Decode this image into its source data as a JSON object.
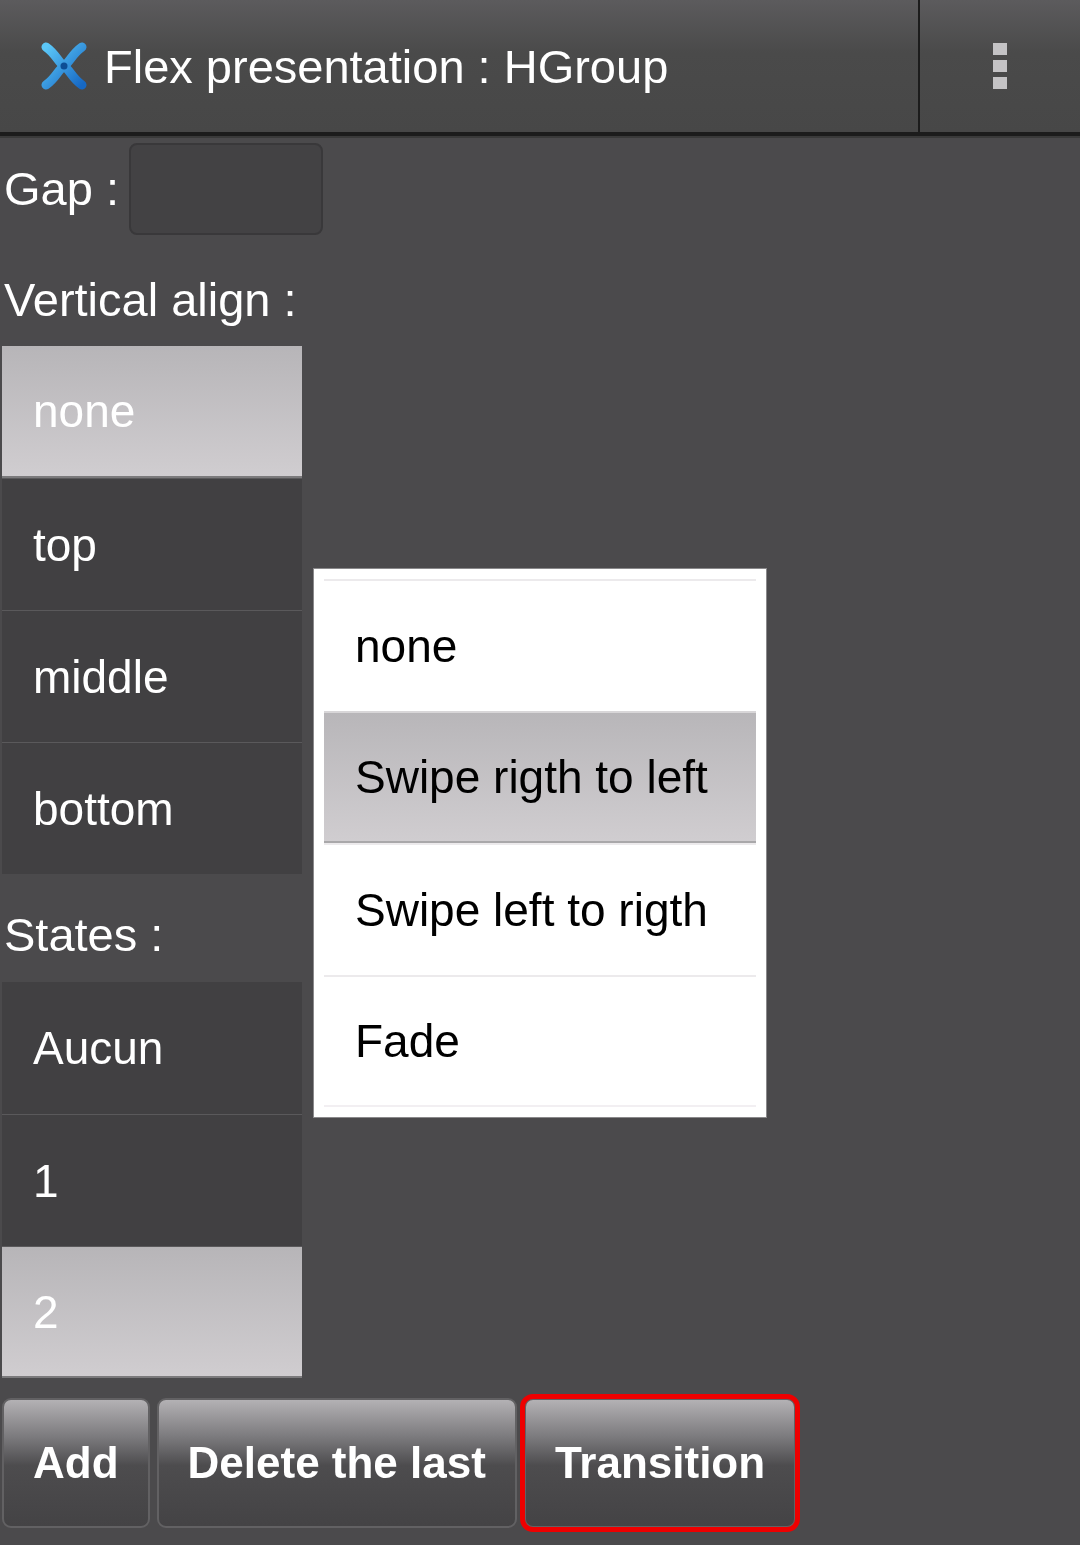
{
  "action_bar": {
    "title": "Flex presentation : HGroup"
  },
  "gap": {
    "label": "Gap :"
  },
  "vertical_align": {
    "label": "Vertical align :",
    "items": [
      {
        "label": "none",
        "selected": true
      },
      {
        "label": "top",
        "selected": false
      },
      {
        "label": "middle",
        "selected": false
      },
      {
        "label": "bottom",
        "selected": false
      }
    ]
  },
  "states": {
    "label": "States :",
    "items": [
      {
        "label": "Aucun",
        "selected": false
      },
      {
        "label": "1",
        "selected": false
      },
      {
        "label": "2",
        "selected": true
      }
    ]
  },
  "buttons": [
    {
      "label": "Add",
      "focused": false
    },
    {
      "label": "Delete the last",
      "focused": false
    },
    {
      "label": "Transition",
      "focused": true
    }
  ],
  "transition_menu": {
    "items": [
      {
        "label": "none",
        "selected": false
      },
      {
        "label": "Swipe rigth to left",
        "selected": true
      },
      {
        "label": "Swipe left to rigth",
        "selected": false
      },
      {
        "label": "Fade",
        "selected": false
      }
    ]
  }
}
